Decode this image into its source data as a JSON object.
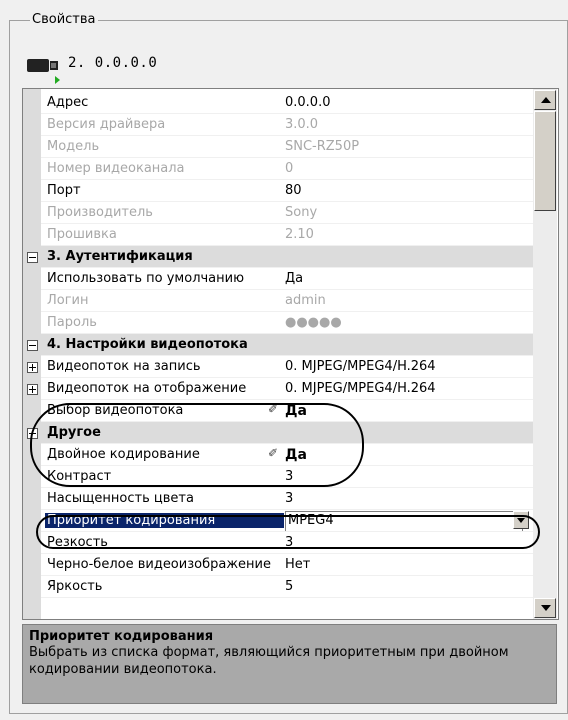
{
  "group": {
    "title": "Свойства"
  },
  "device": {
    "title": "2. 0.0.0.0",
    "icon": "camera-icon"
  },
  "grid": {
    "rows": [
      {
        "name": "Адрес",
        "value": "0.0.0.0",
        "state": "normal"
      },
      {
        "name": "Версия драйвера",
        "value": "3.0.0",
        "state": "disabled"
      },
      {
        "name": "Модель",
        "value": "SNC-RZ50P",
        "state": "disabled"
      },
      {
        "name": "Номер видеоканала",
        "value": "0",
        "state": "disabled"
      },
      {
        "name": "Порт",
        "value": "80",
        "state": "normal"
      },
      {
        "name": "Производитель",
        "value": "Sony",
        "state": "disabled"
      },
      {
        "name": "Прошивка",
        "value": "2.10",
        "state": "disabled"
      },
      {
        "name": "3. Аутентификация",
        "value": "",
        "state": "category"
      },
      {
        "name": "Использовать по умолчанию",
        "value": "Да",
        "state": "normal"
      },
      {
        "name": "Логин",
        "value": "admin",
        "state": "disabled"
      },
      {
        "name": "Пароль",
        "value": "●●●●●",
        "state": "disabled"
      },
      {
        "name": "4. Настройки видеопотока",
        "value": "",
        "state": "category"
      },
      {
        "name": "Видеопоток на запись",
        "value": "0. MJPEG/MPEG4/H.264",
        "state": "expandable"
      },
      {
        "name": "Видеопоток на отображение",
        "value": "0. MJPEG/MPEG4/H.264",
        "state": "expandable"
      },
      {
        "name": "Выбор видеопотока",
        "value": "Да",
        "state": "modified"
      },
      {
        "name": "Другое",
        "value": "",
        "state": "category"
      },
      {
        "name": "Двойное кодирование",
        "value": "Да",
        "state": "modified"
      },
      {
        "name": "Контраст",
        "value": "3",
        "state": "normal"
      },
      {
        "name": "Насыщенность цвета",
        "value": "3",
        "state": "normal"
      },
      {
        "name": "Приоритет кодирования",
        "value": "MPEG4",
        "state": "selected"
      },
      {
        "name": "Резкость",
        "value": "3",
        "state": "normal"
      },
      {
        "name": "Черно-белое видеоизображение",
        "value": "Нет",
        "state": "normal"
      },
      {
        "name": "Яркость",
        "value": "5",
        "state": "normal"
      }
    ]
  },
  "description": {
    "title": "Приоритет кодирования",
    "text": "Выбрать из списка формат, являющийся приоритетным при двойном кодировании видеопотока."
  },
  "colors": {
    "selection": "#0a246a",
    "category_bg": "#dcdcdc",
    "disabled_text": "#a8a8a8"
  }
}
